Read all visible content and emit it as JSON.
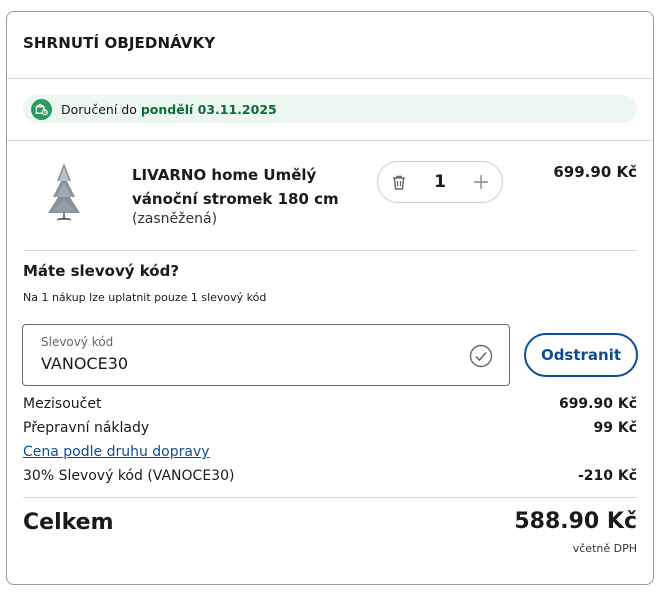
{
  "header": {
    "title": "SHRNUTÍ OBJEDNÁVKY"
  },
  "delivery": {
    "prefix": "Doručení do",
    "date": "pondělí 03.11.2025",
    "icon": "delivery-box-icon"
  },
  "product": {
    "name": "LIVARNO home Umělý vánoční stromek 180 cm",
    "variant": "(zasněžená)",
    "quantity": "1",
    "price": "699.90 Kč"
  },
  "coupon": {
    "title": "Máte slevový kód?",
    "note": "Na 1 nákup lze uplatnit pouze 1 slevový kód",
    "label": "Slevový kód",
    "value": "VANOCE30",
    "remove_label": "Odstranit"
  },
  "summary": {
    "subtotal_label": "Mezisoučet",
    "subtotal_value": "699.90 Kč",
    "shipping_label": "Přepravní náklady",
    "shipping_value": "99 Kč",
    "shipping_link": "Cena podle druhu dopravy",
    "discount_label": "30% Slevový kód (VANOCE30)",
    "discount_value": "-210 Kč",
    "total_label": "Celkem",
    "total_value": "588.90 Kč",
    "vat_note": "včetně DPH"
  },
  "colors": {
    "accent": "#0f4c96",
    "delivery_green": "#2b9a5f",
    "delivery_bg": "#ebf7f0"
  }
}
